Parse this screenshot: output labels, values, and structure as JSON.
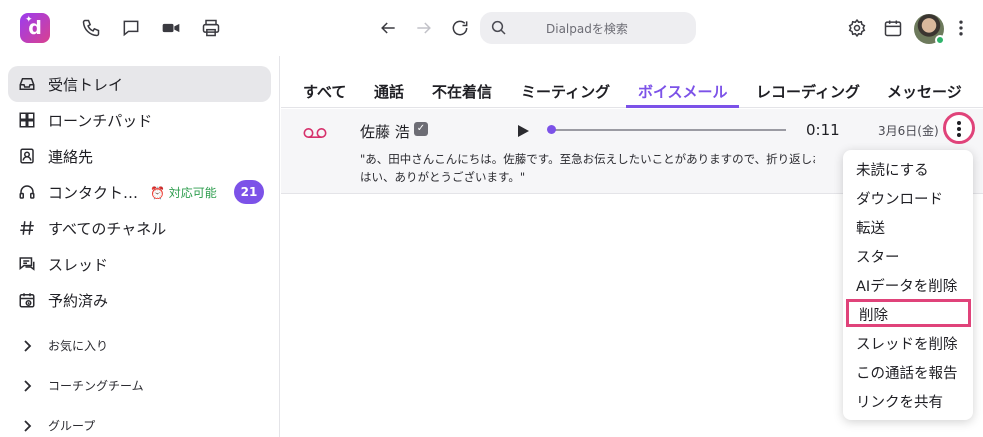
{
  "app": {
    "logo_letter": "d"
  },
  "header": {
    "search_placeholder": "Dialpadを検索",
    "icons": [
      "phone-icon",
      "chat-icon",
      "video-icon",
      "printer-icon",
      "back-arrow-icon",
      "forward-arrow-icon",
      "refresh-icon",
      "search-icon",
      "settings-icon",
      "calendar-icon",
      "more-vertical-icon"
    ]
  },
  "sidebar": {
    "items": [
      {
        "label": "受信トレイ",
        "icon": "inbox-icon",
        "active": true
      },
      {
        "label": "ローンチパッド",
        "icon": "launchpad-icon"
      },
      {
        "label": "連絡先",
        "icon": "contacts-icon"
      },
      {
        "label": "コンタクト…",
        "icon": "headset-icon",
        "status": "対応可能",
        "badge": "21"
      },
      {
        "label": "すべてのチャネル",
        "icon": "hash-icon"
      },
      {
        "label": "スレッド",
        "icon": "threads-icon"
      },
      {
        "label": "予約済み",
        "icon": "scheduled-icon"
      }
    ],
    "groups": [
      {
        "label": "お気に入り"
      },
      {
        "label": "コーチングチーム"
      },
      {
        "label": "グループ"
      }
    ]
  },
  "tabs": [
    {
      "label": "すべて"
    },
    {
      "label": "通話"
    },
    {
      "label": "不在着信"
    },
    {
      "label": "ミーティング"
    },
    {
      "label": "ボイスメール",
      "active": true
    },
    {
      "label": "レコーディング"
    },
    {
      "label": "メッセージ"
    }
  ],
  "message": {
    "sender": "佐藤 浩",
    "duration": "0:11",
    "date": "3月6日(金)",
    "progress": 0,
    "transcript_line1": "\"あ、田中さんこんにちは。佐藤です。至急お伝えしたいことがありますので、折り返しお",
    "transcript_line2": "はい、ありがとうございます。\""
  },
  "context_menu": {
    "items": [
      {
        "label": "未読にする"
      },
      {
        "label": "ダウンロード"
      },
      {
        "label": "転送"
      },
      {
        "label": "スター"
      },
      {
        "label": "AIデータを削除"
      },
      {
        "label": "削除",
        "highlighted": true
      },
      {
        "label": "スレッドを削除"
      },
      {
        "label": "この通話を報告"
      },
      {
        "label": "リンクを共有"
      }
    ]
  },
  "colors": {
    "accent": "#7c52e8",
    "highlight": "#e0437a",
    "status_green": "#2e9d4e",
    "voicemail_red": "#d6306b"
  }
}
